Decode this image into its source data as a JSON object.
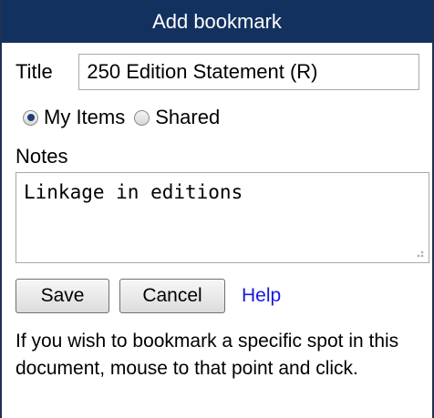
{
  "dialog": {
    "title": "Add bookmark"
  },
  "form": {
    "title_label": "Title",
    "title_value": "250 Edition Statement (R)",
    "scope_options": [
      {
        "label": "My Items",
        "checked": true
      },
      {
        "label": "Shared",
        "checked": false
      }
    ],
    "notes_label": "Notes",
    "notes_value": "Linkage in editions"
  },
  "actions": {
    "save_label": "Save",
    "cancel_label": "Cancel",
    "help_label": "Help"
  },
  "info": {
    "text": "If you wish to bookmark a specific spot in this document, mouse to that point and click."
  },
  "colors": {
    "titlebar_bg": "#13315f",
    "link": "#1818e0"
  },
  "icons": {
    "resize": "resize-grip-icon"
  }
}
